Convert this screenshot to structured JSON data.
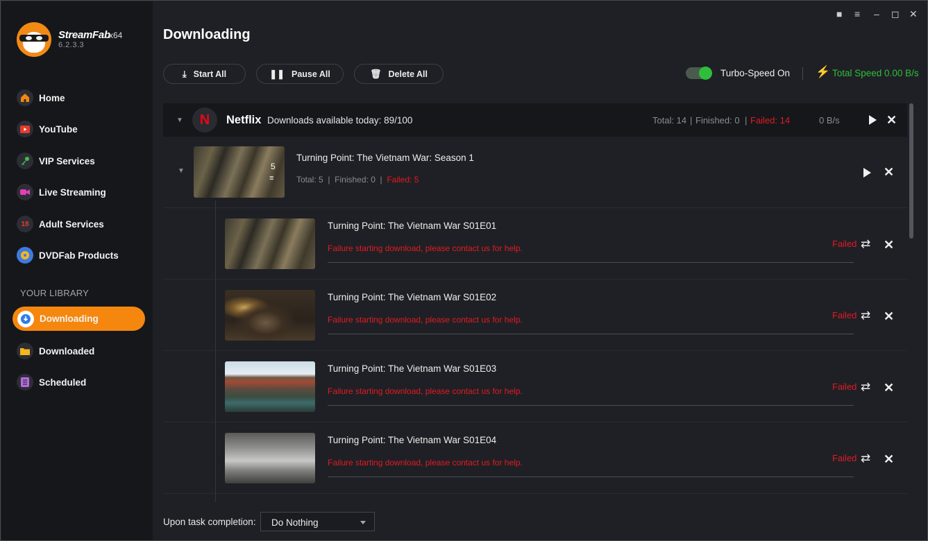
{
  "app": {
    "brand": "StreamFab",
    "arch": "x64",
    "version": "6.2.3.3"
  },
  "window_controls": [
    "shirt-icon",
    "menu-icon",
    "minimize-icon",
    "maximize-icon",
    "close-icon"
  ],
  "sidebar": {
    "items": [
      {
        "label": "Home",
        "icon": "home-icon",
        "color": "#f5870f"
      },
      {
        "label": "YouTube",
        "icon": "youtube-icon",
        "color": "#e53a2e"
      },
      {
        "label": "VIP Services",
        "icon": "key-icon",
        "color": "#3fbf4a"
      },
      {
        "label": "Live Streaming",
        "icon": "camera-icon",
        "color": "#e23fb9"
      },
      {
        "label": "Adult Services",
        "icon": "adult-18-icon",
        "color": "#e53a2e"
      },
      {
        "label": "DVDFab Products",
        "icon": "dvdfab-icon",
        "color": "#f5870f"
      }
    ],
    "library_heading": "YOUR LIBRARY",
    "library": [
      {
        "label": "Downloading",
        "icon": "download-arrow-icon",
        "active": true
      },
      {
        "label": "Downloaded",
        "icon": "folder-icon",
        "color": "#f5b51c"
      },
      {
        "label": "Scheduled",
        "icon": "calendar-list-icon",
        "color": "#b86be0"
      }
    ]
  },
  "header": {
    "title": "Downloading"
  },
  "toolbar": {
    "start_all": "Start All",
    "pause_all": "Pause All",
    "delete_all": "Delete All"
  },
  "turbo": {
    "label": "Turbo-Speed On",
    "enabled": true,
    "accent": "#2fbe3b"
  },
  "total_speed": "Total Speed 0.00 B/s",
  "group": {
    "service": "Netflix",
    "availability": "Downloads available today: 89/100",
    "total": "Total: 14",
    "finished": "Finished: 0",
    "failed": "Failed: 14",
    "speed": "0 B/s",
    "sep": "|"
  },
  "season": {
    "title": "Turning Point: The Vietnam War: Season 1",
    "count": "5",
    "total": "Total: 5",
    "finished": "Finished: 0",
    "failed": "Failed: 5",
    "sep": "|"
  },
  "episodes": [
    {
      "title": "Turning Point: The Vietnam War S01E01",
      "error": "Failure starting download, please contact us for help.",
      "status": "Failed"
    },
    {
      "title": "Turning Point: The Vietnam War S01E02",
      "error": "Failure starting download, please contact us for help.",
      "status": "Failed"
    },
    {
      "title": "Turning Point: The Vietnam War S01E03",
      "error": "Failure starting download, please contact us for help.",
      "status": "Failed"
    },
    {
      "title": "Turning Point: The Vietnam War S01E04",
      "error": "Failure starting download, please contact us for help.",
      "status": "Failed"
    }
  ],
  "footer": {
    "label": "Upon task completion:",
    "select_value": "Do Nothing"
  },
  "colors": {
    "accent": "#f5870f",
    "failed": "#e11b22",
    "green": "#2fbe3b"
  }
}
